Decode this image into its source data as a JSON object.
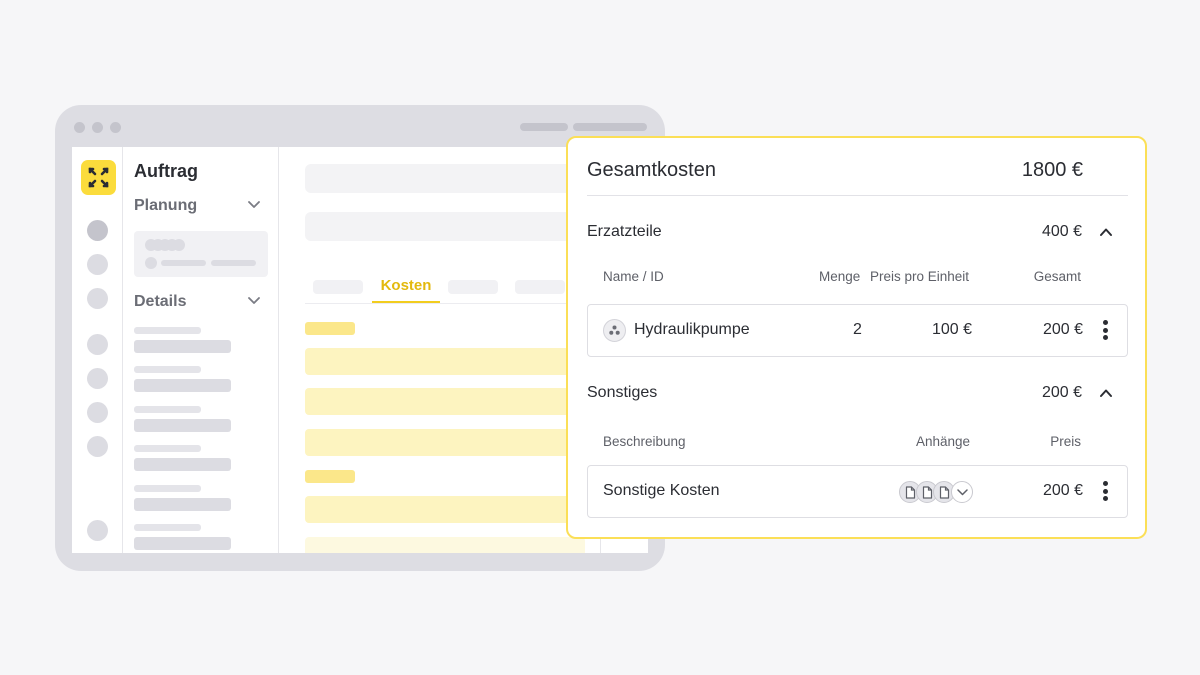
{
  "app": {
    "nav_title": "Auftrag",
    "sections": [
      {
        "label": "Planung"
      },
      {
        "label": "Details"
      }
    ],
    "active_tab": "Kosten"
  },
  "cost_card": {
    "title": "Gesamtkosten",
    "total": "1800 €",
    "spare_parts": {
      "title": "Erzatzteile",
      "amount": "400 €",
      "columns": {
        "name": "Name / ID",
        "quantity": "Menge",
        "unit_price": "Preis pro Einheit",
        "total": "Gesamt"
      },
      "rows": [
        {
          "name": "Hydraulikpumpe",
          "quantity": "2",
          "unit_price": "100 €",
          "total": "200 €",
          "icon": "part-icon"
        }
      ]
    },
    "other": {
      "title": "Sonstiges",
      "amount": "200 €",
      "columns": {
        "description": "Beschreibung",
        "attachments": "Anhänge",
        "price": "Preis"
      },
      "rows": [
        {
          "description": "Sonstige Kosten",
          "price": "200 €",
          "attachment_icons": [
            "document-icon",
            "document-icon",
            "document-icon",
            "chevron-down-icon"
          ]
        }
      ]
    }
  },
  "colors": {
    "accent": "#fbdc3c",
    "accent_text": "#e3b90e",
    "card_border": "#fbdf57",
    "text": "#2b2d33"
  }
}
